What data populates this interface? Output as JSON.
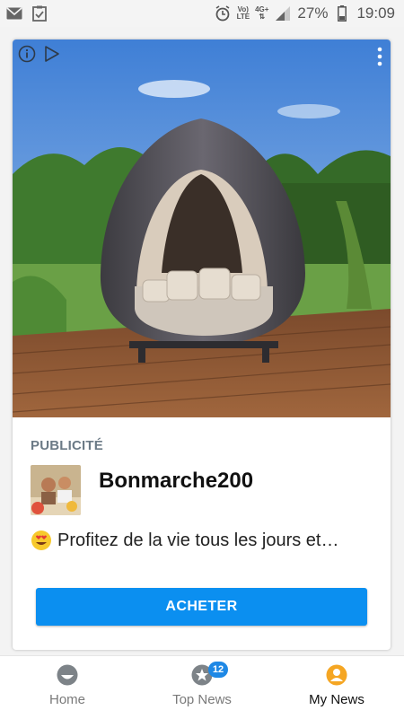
{
  "status_bar": {
    "left_icons": [
      "mail-icon",
      "clipboard-check-icon"
    ],
    "network_top": "Vo)",
    "network_bottom": "LTE",
    "data_type": "4G+",
    "battery_percent": "27%",
    "time": "19:09"
  },
  "ad_card": {
    "sponsored_label": "PUBLICITÉ",
    "advertiser_name": "Bonmarche200",
    "text": "Profitez de la vie tous les jours et…",
    "cta_label": "ACHETER",
    "icons": [
      "info-icon",
      "ad-choices-icon",
      "more-vert-icon",
      "smiling-face-heart-eyes-icon"
    ]
  },
  "bottom_nav": {
    "items": [
      {
        "label": "Home",
        "icon": "home-face-icon",
        "active": false
      },
      {
        "label": "Top News",
        "icon": "star-icon",
        "badge": "12",
        "active": false
      },
      {
        "label": "My News",
        "icon": "user-circle-icon",
        "active": true
      }
    ]
  },
  "colors": {
    "cta": "#0b8ff0",
    "active_nav_icon": "#f5a623",
    "badge": "#1e88e5"
  }
}
